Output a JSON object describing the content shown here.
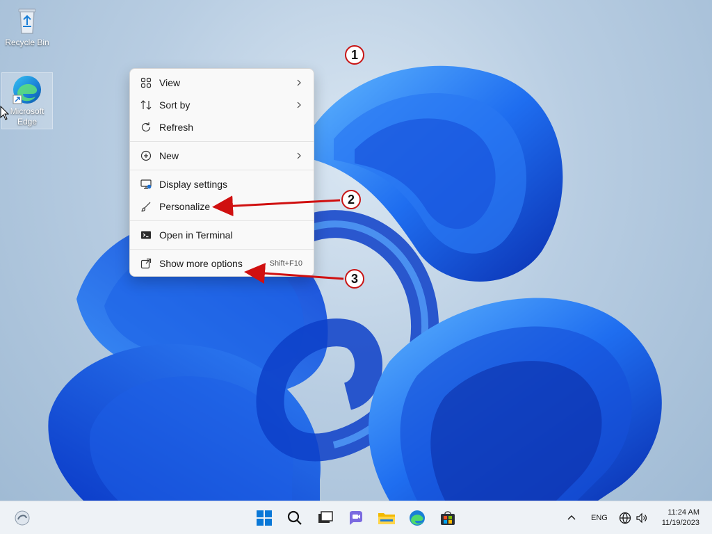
{
  "desktop": {
    "icons": [
      {
        "label": "Recycle Bin",
        "icon": "recycle-bin-icon"
      },
      {
        "label": "Microsoft Edge",
        "label_line1": "Microsoft",
        "label_line2": "Edge",
        "icon": "edge-icon"
      }
    ]
  },
  "context_menu": {
    "items": [
      {
        "label": "View",
        "icon": "grid-icon",
        "submenu": true
      },
      {
        "label": "Sort by",
        "icon": "sort-icon",
        "submenu": true
      },
      {
        "label": "Refresh",
        "icon": "refresh-icon"
      },
      {
        "label": "New",
        "icon": "plus-circle-icon",
        "submenu": true
      },
      {
        "label": "Display settings",
        "icon": "display-settings-icon"
      },
      {
        "label": "Personalize",
        "icon": "brush-icon"
      },
      {
        "label": "Open in Terminal",
        "icon": "terminal-icon"
      },
      {
        "label": "Show more options",
        "icon": "external-icon",
        "shortcut": "Shift+F10"
      }
    ]
  },
  "annotations": {
    "one": "1",
    "two": "2",
    "three": "3",
    "color": "#d01010"
  },
  "taskbar": {
    "apps": [
      "widgets-icon",
      "start-icon",
      "search-icon",
      "task-view-icon",
      "chat-icon",
      "file-explorer-icon",
      "edge-icon",
      "store-icon"
    ],
    "language": "ENG",
    "time": "11:24 AM",
    "date": "11/19/2023"
  },
  "colors": {
    "accent": "#0067c0",
    "wallpaper_blue": "#1b5ee8"
  }
}
